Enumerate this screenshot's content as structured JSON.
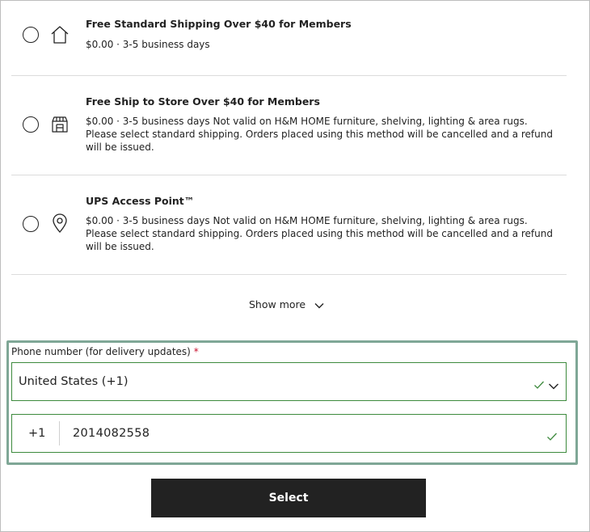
{
  "shipping_options": [
    {
      "icon": "home-icon",
      "title": "Free Standard Shipping Over $40 for Members",
      "description": "$0.00 · 3-5 business days"
    },
    {
      "icon": "store-icon",
      "title": "Free Ship to Store Over $40 for Members",
      "description": "$0.00 · 3-5 business days Not valid on H&M HOME furniture, shelving, lighting & area rugs. Please select standard shipping. Orders placed using this method will be cancelled and a refund will be issued."
    },
    {
      "icon": "location-pin-icon",
      "title": "UPS Access Point™",
      "description": "$0.00 · 3-5 business days Not valid on H&M HOME furniture, shelving, lighting & area rugs. Please select standard shipping. Orders placed using this method will be cancelled and a refund will be issued."
    }
  ],
  "show_more_label": "Show more",
  "phone": {
    "label": "Phone number (for delivery updates)",
    "required_marker": "*",
    "country_value": "United States (+1)",
    "prefix": "+1",
    "number_value": "2014082558"
  },
  "select_button_label": "Select",
  "colors": {
    "valid_green": "#3d8a3d",
    "focus_outline": "#7fa796",
    "required_red": "#c8102e",
    "button_bg": "#222222"
  }
}
